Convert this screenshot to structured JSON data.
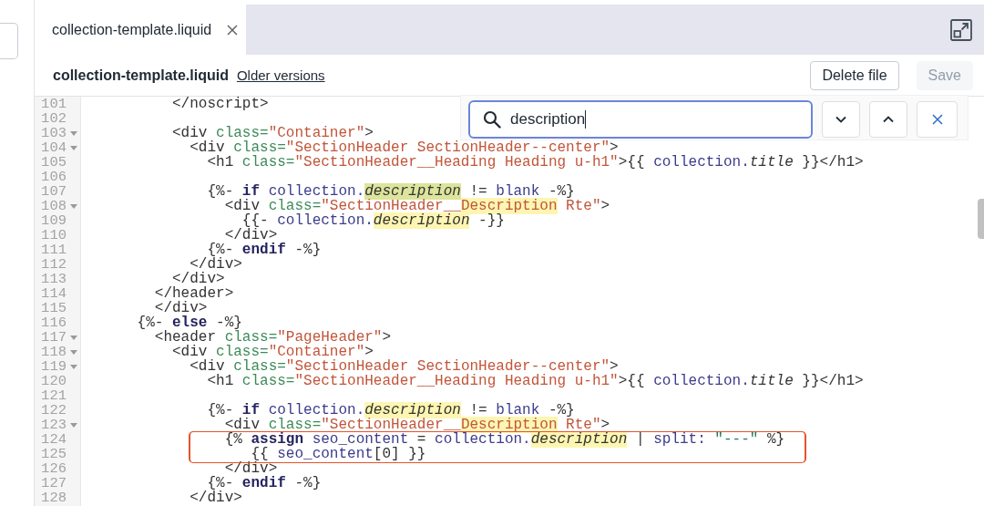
{
  "tabs": [
    {
      "label": "collection-template.liquid",
      "selected": true
    }
  ],
  "file_header": {
    "title": "collection-template.liquid",
    "link": "Older versions",
    "delete_button": {
      "label": "Delete file",
      "disabled": false
    },
    "save_button": {
      "label": "Save",
      "disabled": true
    }
  },
  "search": {
    "value": "description"
  },
  "code": {
    "lines": [
      {
        "number": "101",
        "fold": false,
        "boxed": false,
        "tokens": [
          {
            "text": "          </noscript>",
            "kind": "tag",
            "match": false
          }
        ]
      },
      {
        "number": "102",
        "fold": false,
        "boxed": false
      },
      {
        "number": "103",
        "fold": true,
        "boxed": false,
        "tokens": [
          {
            "text": "          <div ",
            "kind": "tag",
            "match": false
          },
          {
            "text": "class=",
            "kind": "attr",
            "match": false
          },
          {
            "text": "\"Container\"",
            "kind": "string",
            "match": false
          },
          {
            "text": ">",
            "kind": "tag",
            "match": false
          }
        ]
      },
      {
        "number": "104",
        "fold": true,
        "boxed": false,
        "tokens": [
          {
            "text": "            <div ",
            "kind": "tag",
            "match": false
          },
          {
            "text": "class=",
            "kind": "attr",
            "match": false
          },
          {
            "text": "\"SectionHeader SectionHeader--center\"",
            "kind": "string",
            "match": false
          },
          {
            "text": ">",
            "kind": "tag",
            "match": false
          }
        ]
      },
      {
        "number": "105",
        "fold": false,
        "boxed": false,
        "tokens": [
          {
            "text": "              <h1 ",
            "kind": "tag",
            "match": false
          },
          {
            "text": "class=",
            "kind": "attr",
            "match": false
          },
          {
            "text": "\"SectionHeader__Heading Heading u-h1\"",
            "kind": "string",
            "match": false
          },
          {
            "text": ">",
            "kind": "tag",
            "match": false
          },
          {
            "text": "{{ ",
            "kind": "delim",
            "match": false
          },
          {
            "text": "collection.",
            "kind": "variable",
            "match": false
          },
          {
            "text": "title",
            "kind": "property",
            "match": false
          },
          {
            "text": " }}",
            "kind": "delim",
            "match": false
          },
          {
            "text": "</h1>",
            "kind": "tag",
            "match": false
          }
        ]
      },
      {
        "number": "106",
        "fold": false,
        "boxed": false
      },
      {
        "number": "107",
        "fold": false,
        "boxed": false,
        "tokens": [
          {
            "text": "              {%- ",
            "kind": "delim",
            "match": false
          },
          {
            "text": "if",
            "kind": "keyword",
            "match": false
          },
          {
            "text": " collection.",
            "kind": "variable",
            "match": false
          },
          {
            "text": "description",
            "kind": "property",
            "match": true,
            "current": true
          },
          {
            "text": " != ",
            "kind": "delim",
            "match": false
          },
          {
            "text": "blank",
            "kind": "variable",
            "match": false
          },
          {
            "text": " -%}",
            "kind": "delim",
            "match": false
          }
        ]
      },
      {
        "number": "108",
        "fold": true,
        "boxed": false,
        "tokens": [
          {
            "text": "                <div ",
            "kind": "tag",
            "match": false
          },
          {
            "text": "class=",
            "kind": "attr",
            "match": false
          },
          {
            "text": "\"SectionHeader__",
            "kind": "string",
            "match": false
          },
          {
            "text": "Description",
            "kind": "string",
            "match": true,
            "current": false
          },
          {
            "text": " Rte\"",
            "kind": "string",
            "match": false
          },
          {
            "text": ">",
            "kind": "tag",
            "match": false
          }
        ]
      },
      {
        "number": "109",
        "fold": false,
        "boxed": false,
        "tokens": [
          {
            "text": "                  {{- ",
            "kind": "delim",
            "match": false
          },
          {
            "text": "collection.",
            "kind": "variable",
            "match": false
          },
          {
            "text": "description",
            "kind": "property",
            "match": true,
            "current": false
          },
          {
            "text": " -}}",
            "kind": "delim",
            "match": false
          }
        ]
      },
      {
        "number": "110",
        "fold": false,
        "boxed": false,
        "tokens": [
          {
            "text": "                </div>",
            "kind": "tag",
            "match": false
          }
        ]
      },
      {
        "number": "111",
        "fold": false,
        "boxed": false,
        "tokens": [
          {
            "text": "              {%- ",
            "kind": "delim",
            "match": false
          },
          {
            "text": "endif",
            "kind": "keyword",
            "match": false
          },
          {
            "text": " -%}",
            "kind": "delim",
            "match": false
          }
        ]
      },
      {
        "number": "112",
        "fold": false,
        "boxed": false,
        "tokens": [
          {
            "text": "            </div>",
            "kind": "tag",
            "match": false
          }
        ]
      },
      {
        "number": "113",
        "fold": false,
        "boxed": false,
        "tokens": [
          {
            "text": "          </div>",
            "kind": "tag",
            "match": false
          }
        ]
      },
      {
        "number": "114",
        "fold": false,
        "boxed": false,
        "tokens": [
          {
            "text": "        </header>",
            "kind": "tag",
            "match": false
          }
        ]
      },
      {
        "number": "115",
        "fold": false,
        "boxed": false,
        "tokens": [
          {
            "text": "        </div>",
            "kind": "tag",
            "match": false
          }
        ]
      },
      {
        "number": "116",
        "fold": false,
        "boxed": false,
        "tokens": [
          {
            "text": "      {%- ",
            "kind": "delim",
            "match": false
          },
          {
            "text": "else",
            "kind": "keyword",
            "match": false
          },
          {
            "text": " -%}",
            "kind": "delim",
            "match": false
          }
        ]
      },
      {
        "number": "117",
        "fold": true,
        "boxed": false,
        "tokens": [
          {
            "text": "        <header ",
            "kind": "tag",
            "match": false
          },
          {
            "text": "class=",
            "kind": "attr",
            "match": false
          },
          {
            "text": "\"PageHeader\"",
            "kind": "string",
            "match": false
          },
          {
            "text": ">",
            "kind": "tag",
            "match": false
          }
        ]
      },
      {
        "number": "118",
        "fold": true,
        "boxed": false,
        "tokens": [
          {
            "text": "          <div ",
            "kind": "tag",
            "match": false
          },
          {
            "text": "class=",
            "kind": "attr",
            "match": false
          },
          {
            "text": "\"Container\"",
            "kind": "string",
            "match": false
          },
          {
            "text": ">",
            "kind": "tag",
            "match": false
          }
        ]
      },
      {
        "number": "119",
        "fold": true,
        "boxed": false,
        "tokens": [
          {
            "text": "            <div ",
            "kind": "tag",
            "match": false
          },
          {
            "text": "class=",
            "kind": "attr",
            "match": false
          },
          {
            "text": "\"SectionHeader SectionHeader--center\"",
            "kind": "string",
            "match": false
          },
          {
            "text": ">",
            "kind": "tag",
            "match": false
          }
        ]
      },
      {
        "number": "120",
        "fold": false,
        "boxed": false,
        "tokens": [
          {
            "text": "              <h1 ",
            "kind": "tag",
            "match": false
          },
          {
            "text": "class=",
            "kind": "attr",
            "match": false
          },
          {
            "text": "\"SectionHeader__Heading Heading u-h1\"",
            "kind": "string",
            "match": false
          },
          {
            "text": ">",
            "kind": "tag",
            "match": false
          },
          {
            "text": "{{ ",
            "kind": "delim",
            "match": false
          },
          {
            "text": "collection.",
            "kind": "variable",
            "match": false
          },
          {
            "text": "title",
            "kind": "property",
            "match": false
          },
          {
            "text": " }}",
            "kind": "delim",
            "match": false
          },
          {
            "text": "</h1>",
            "kind": "tag",
            "match": false
          }
        ]
      },
      {
        "number": "121",
        "fold": false,
        "boxed": false
      },
      {
        "number": "122",
        "fold": false,
        "boxed": false,
        "tokens": [
          {
            "text": "              {%- ",
            "kind": "delim",
            "match": false
          },
          {
            "text": "if",
            "kind": "keyword",
            "match": false
          },
          {
            "text": " collection.",
            "kind": "variable",
            "match": false
          },
          {
            "text": "description",
            "kind": "property",
            "match": true,
            "current": false
          },
          {
            "text": " != ",
            "kind": "delim",
            "match": false
          },
          {
            "text": "blank",
            "kind": "variable",
            "match": false
          },
          {
            "text": " -%}",
            "kind": "delim",
            "match": false
          }
        ]
      },
      {
        "number": "123",
        "fold": true,
        "boxed": false,
        "tokens": [
          {
            "text": "                <div ",
            "kind": "tag",
            "match": false
          },
          {
            "text": "class=",
            "kind": "attr",
            "match": false
          },
          {
            "text": "\"SectionHeader__",
            "kind": "string",
            "match": false
          },
          {
            "text": "Description",
            "kind": "string",
            "match": true,
            "current": false
          },
          {
            "text": " Rte\"",
            "kind": "string",
            "match": false
          },
          {
            "text": ">",
            "kind": "tag",
            "match": false
          }
        ]
      },
      {
        "number": "124",
        "fold": false,
        "boxed": true,
        "tokens": [
          {
            "text": "                {% ",
            "kind": "delim",
            "match": false
          },
          {
            "text": "assign",
            "kind": "keyword",
            "match": false
          },
          {
            "text": " seo_content",
            "kind": "variable",
            "match": false
          },
          {
            "text": " = ",
            "kind": "delim",
            "match": false
          },
          {
            "text": "collection.",
            "kind": "variable",
            "match": false
          },
          {
            "text": "description",
            "kind": "property",
            "match": true,
            "current": false
          },
          {
            "text": " | ",
            "kind": "delim",
            "match": false
          },
          {
            "text": "split: ",
            "kind": "variable",
            "match": false
          },
          {
            "text": "\"---\"",
            "kind": "literal",
            "match": false
          },
          {
            "text": " %}",
            "kind": "delim",
            "match": false
          }
        ]
      },
      {
        "number": "125",
        "fold": false,
        "boxed": true,
        "tokens": [
          {
            "text": "                   {{ ",
            "kind": "delim",
            "match": false
          },
          {
            "text": "seo_content",
            "kind": "variable",
            "match": false
          },
          {
            "text": "[0] }}",
            "kind": "delim",
            "match": false
          }
        ]
      },
      {
        "number": "126",
        "fold": false,
        "boxed": false,
        "tokens": [
          {
            "text": "                </div>",
            "kind": "tag",
            "match": false
          }
        ]
      },
      {
        "number": "127",
        "fold": false,
        "boxed": false,
        "tokens": [
          {
            "text": "              {%- ",
            "kind": "delim",
            "match": false
          },
          {
            "text": "endif",
            "kind": "keyword",
            "match": false
          },
          {
            "text": " -%}",
            "kind": "delim",
            "match": false
          }
        ]
      },
      {
        "number": "128",
        "fold": false,
        "boxed": false,
        "tokens": [
          {
            "text": "            </div>",
            "kind": "tag",
            "match": false
          }
        ]
      }
    ]
  }
}
